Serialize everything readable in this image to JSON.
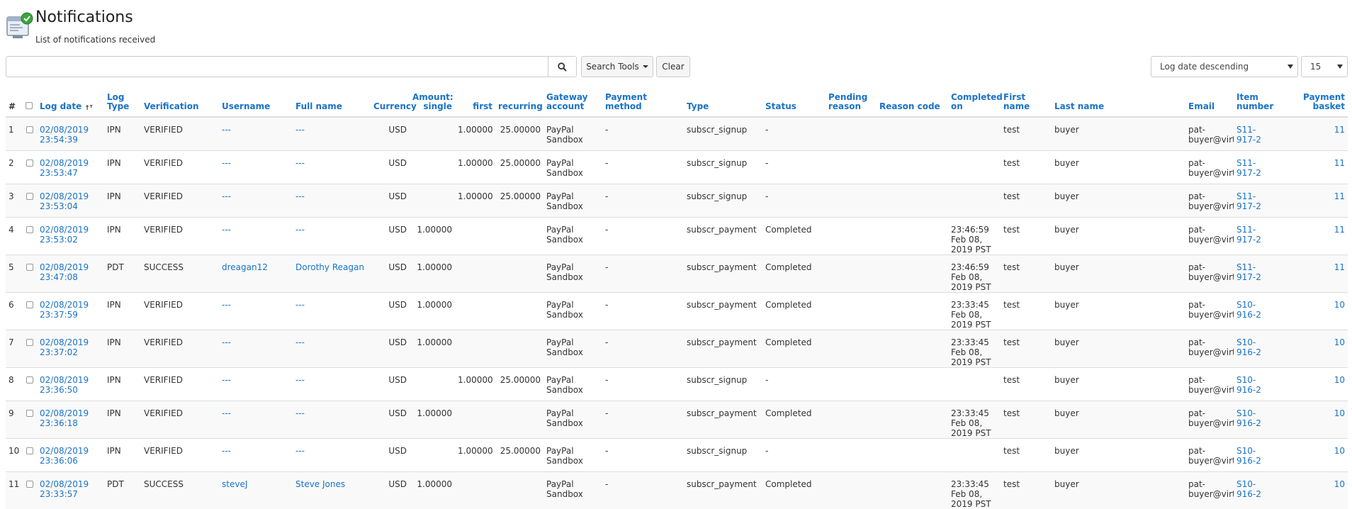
{
  "header": {
    "title": "Notifications",
    "subtitle": "List of notifications received"
  },
  "toolbar": {
    "search_value": "",
    "search_tools_label": "Search Tools",
    "clear_label": "Clear",
    "sort_selected": "Log date descending",
    "limit_selected": "15"
  },
  "table": {
    "columns": {
      "num": "#",
      "log_date": "Log date",
      "log_type": "Log Type",
      "verification": "Verification",
      "username": "Username",
      "full_name": "Full name",
      "currency": "Currency",
      "amount_single": "Amount: single",
      "first": "first",
      "recurring": "recurring",
      "gateway_account": "Gateway account",
      "payment_method": "Payment method",
      "type": "Type",
      "status": "Status",
      "pending_reason": "Pending reason",
      "reason_code": "Reason code",
      "completed_on": "Completed on",
      "first_name": "First name",
      "last_name": "Last name",
      "email": "Email",
      "item_number": "Item number",
      "payment_basket": "Payment basket"
    },
    "rows": [
      {
        "num": "1",
        "date": "02/08/2019",
        "time": "23:54:39",
        "log_type": "IPN",
        "verification": "VERIFIED",
        "username": "---",
        "full_name": "---",
        "currency": "USD",
        "amount": "",
        "first": "1.00000",
        "recurring": "25.00000",
        "gateway": "PayPal Sandbox",
        "method": "-",
        "type": "subscr_signup",
        "status": "-",
        "pending": "",
        "reason": "",
        "completed": "",
        "first_name": "test",
        "last_name": "buyer",
        "email": "pat-buyer@virtualcityservices.com",
        "item": "S11-917-2",
        "basket": "11"
      },
      {
        "num": "2",
        "date": "02/08/2019",
        "time": "23:53:47",
        "log_type": "IPN",
        "verification": "VERIFIED",
        "username": "---",
        "full_name": "---",
        "currency": "USD",
        "amount": "",
        "first": "1.00000",
        "recurring": "25.00000",
        "gateway": "PayPal Sandbox",
        "method": "-",
        "type": "subscr_signup",
        "status": "-",
        "pending": "",
        "reason": "",
        "completed": "",
        "first_name": "test",
        "last_name": "buyer",
        "email": "pat-buyer@virtualcityservices.com",
        "item": "S11-917-2",
        "basket": "11"
      },
      {
        "num": "3",
        "date": "02/08/2019",
        "time": "23:53:04",
        "log_type": "IPN",
        "verification": "VERIFIED",
        "username": "---",
        "full_name": "---",
        "currency": "USD",
        "amount": "",
        "first": "1.00000",
        "recurring": "25.00000",
        "gateway": "PayPal Sandbox",
        "method": "-",
        "type": "subscr_signup",
        "status": "-",
        "pending": "",
        "reason": "",
        "completed": "",
        "first_name": "test",
        "last_name": "buyer",
        "email": "pat-buyer@virtualcityservices.com",
        "item": "S11-917-2",
        "basket": "11"
      },
      {
        "num": "4",
        "date": "02/08/2019",
        "time": "23:53:02",
        "log_type": "IPN",
        "verification": "VERIFIED",
        "username": "---",
        "full_name": "---",
        "currency": "USD",
        "amount": "1.00000",
        "first": "",
        "recurring": "",
        "gateway": "PayPal Sandbox",
        "method": "-",
        "type": "subscr_payment",
        "status": "Completed",
        "pending": "",
        "reason": "",
        "completed": "23:46:59 Feb 08, 2019 PST",
        "first_name": "test",
        "last_name": "buyer",
        "email": "pat-buyer@virtualcityservices.com",
        "item": "S11-917-2",
        "basket": "11"
      },
      {
        "num": "5",
        "date": "02/08/2019",
        "time": "23:47:08",
        "log_type": "PDT",
        "verification": "SUCCESS",
        "username": "dreagan12",
        "full_name": "Dorothy Reagan",
        "currency": "USD",
        "amount": "1.00000",
        "first": "",
        "recurring": "",
        "gateway": "PayPal Sandbox",
        "method": "-",
        "type": "subscr_payment",
        "status": "Completed",
        "pending": "",
        "reason": "",
        "completed": "23:46:59 Feb 08, 2019 PST",
        "first_name": "test",
        "last_name": "buyer",
        "email": "pat-buyer@virtualcityservices.com",
        "item": "S11-917-2",
        "basket": "11"
      },
      {
        "num": "6",
        "date": "02/08/2019",
        "time": "23:37:59",
        "log_type": "IPN",
        "verification": "VERIFIED",
        "username": "---",
        "full_name": "---",
        "currency": "USD",
        "amount": "1.00000",
        "first": "",
        "recurring": "",
        "gateway": "PayPal Sandbox",
        "method": "-",
        "type": "subscr_payment",
        "status": "Completed",
        "pending": "",
        "reason": "",
        "completed": "23:33:45 Feb 08, 2019 PST",
        "first_name": "test",
        "last_name": "buyer",
        "email": "pat-buyer@virtualcityservices.com",
        "item": "S10-916-2",
        "basket": "10"
      },
      {
        "num": "7",
        "date": "02/08/2019",
        "time": "23:37:02",
        "log_type": "IPN",
        "verification": "VERIFIED",
        "username": "---",
        "full_name": "---",
        "currency": "USD",
        "amount": "1.00000",
        "first": "",
        "recurring": "",
        "gateway": "PayPal Sandbox",
        "method": "-",
        "type": "subscr_payment",
        "status": "Completed",
        "pending": "",
        "reason": "",
        "completed": "23:33:45 Feb 08, 2019 PST",
        "first_name": "test",
        "last_name": "buyer",
        "email": "pat-buyer@virtualcityservices.com",
        "item": "S10-916-2",
        "basket": "10"
      },
      {
        "num": "8",
        "date": "02/08/2019",
        "time": "23:36:50",
        "log_type": "IPN",
        "verification": "VERIFIED",
        "username": "---",
        "full_name": "---",
        "currency": "USD",
        "amount": "",
        "first": "1.00000",
        "recurring": "25.00000",
        "gateway": "PayPal Sandbox",
        "method": "-",
        "type": "subscr_signup",
        "status": "-",
        "pending": "",
        "reason": "",
        "completed": "",
        "first_name": "test",
        "last_name": "buyer",
        "email": "pat-buyer@virtualcityservices.com",
        "item": "S10-916-2",
        "basket": "10"
      },
      {
        "num": "9",
        "date": "02/08/2019",
        "time": "23:36:18",
        "log_type": "IPN",
        "verification": "VERIFIED",
        "username": "---",
        "full_name": "---",
        "currency": "USD",
        "amount": "1.00000",
        "first": "",
        "recurring": "",
        "gateway": "PayPal Sandbox",
        "method": "-",
        "type": "subscr_payment",
        "status": "Completed",
        "pending": "",
        "reason": "",
        "completed": "23:33:45 Feb 08, 2019 PST",
        "first_name": "test",
        "last_name": "buyer",
        "email": "pat-buyer@virtualcityservices.com",
        "item": "S10-916-2",
        "basket": "10"
      },
      {
        "num": "10",
        "date": "02/08/2019",
        "time": "23:36:06",
        "log_type": "IPN",
        "verification": "VERIFIED",
        "username": "---",
        "full_name": "---",
        "currency": "USD",
        "amount": "",
        "first": "1.00000",
        "recurring": "25.00000",
        "gateway": "PayPal Sandbox",
        "method": "-",
        "type": "subscr_signup",
        "status": "-",
        "pending": "",
        "reason": "",
        "completed": "",
        "first_name": "test",
        "last_name": "buyer",
        "email": "pat-buyer@virtualcityservices.com",
        "item": "S10-916-2",
        "basket": "10"
      },
      {
        "num": "11",
        "date": "02/08/2019",
        "time": "23:33:57",
        "log_type": "PDT",
        "verification": "SUCCESS",
        "username": "steveJ",
        "full_name": "Steve Jones",
        "currency": "USD",
        "amount": "1.00000",
        "first": "",
        "recurring": "",
        "gateway": "PayPal Sandbox",
        "method": "-",
        "type": "subscr_payment",
        "status": "Completed",
        "pending": "",
        "reason": "",
        "completed": "23:33:45 Feb 08, 2019 PST",
        "first_name": "test",
        "last_name": "buyer",
        "email": "pat-buyer@virtualcityservices.com",
        "item": "S10-916-2",
        "basket": "10"
      }
    ]
  },
  "colors": {
    "link": "#1a73c8",
    "row_stripe": "#f9f9f9",
    "border": "#dddddd",
    "icon_green": "#3aa53a"
  },
  "icons": {
    "header": "notifications-icon",
    "search": "search-icon",
    "sort": "sort-az-icon",
    "caret": "caret-down-icon"
  }
}
